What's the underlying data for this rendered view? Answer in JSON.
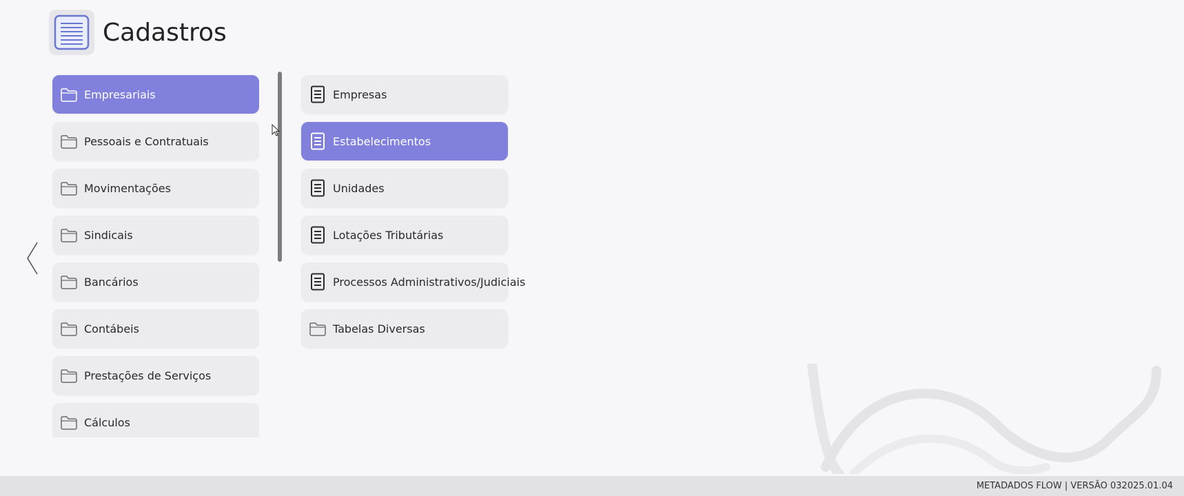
{
  "header": {
    "title": "Cadastros",
    "icon": "document-list-icon"
  },
  "categories": [
    {
      "label": "Empresariais",
      "icon": "folder-icon",
      "active": true
    },
    {
      "label": "Pessoais e Contratuais",
      "icon": "folder-icon",
      "active": false
    },
    {
      "label": "Movimentações",
      "icon": "folder-icon",
      "active": false
    },
    {
      "label": "Sindicais",
      "icon": "folder-icon",
      "active": false
    },
    {
      "label": "Bancários",
      "icon": "folder-icon",
      "active": false
    },
    {
      "label": "Contábeis",
      "icon": "folder-icon",
      "active": false
    },
    {
      "label": "Prestações de Serviços",
      "icon": "folder-icon",
      "active": false
    },
    {
      "label": "Cálculos",
      "icon": "folder-icon",
      "active": false
    }
  ],
  "subitems": [
    {
      "label": "Empresas",
      "icon": "document-icon",
      "active": false
    },
    {
      "label": "Estabelecimentos",
      "icon": "document-icon",
      "active": true
    },
    {
      "label": "Unidades",
      "icon": "document-icon",
      "active": false
    },
    {
      "label": "Lotações Tributárias",
      "icon": "document-icon",
      "active": false
    },
    {
      "label": "Processos Administrativos/Judiciais",
      "icon": "document-icon",
      "active": false
    },
    {
      "label": "Tabelas Diversas",
      "icon": "folder-icon",
      "active": false
    }
  ],
  "footer": {
    "version_text": "METADADOS FLOW | VERSÃO 032025.01.04"
  },
  "colors": {
    "accent": "#8280dd",
    "item_bg": "#ececef",
    "page_bg": "#f7f7f9"
  }
}
